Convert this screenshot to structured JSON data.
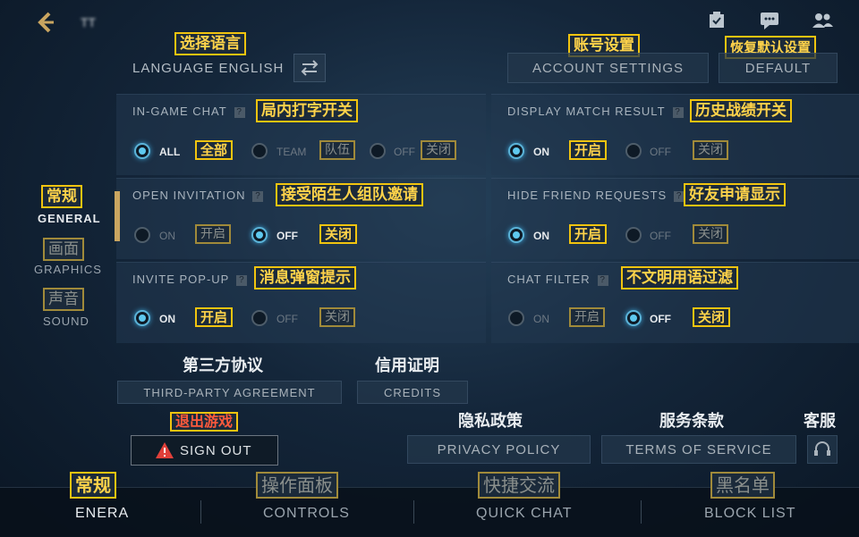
{
  "top": {
    "title_obscured": "TT"
  },
  "language": {
    "label": "LANGUAGE ENGLISH",
    "cn": "选择语言"
  },
  "account": {
    "label": "ACCOUNT SETTINGS",
    "cn": "账号设置"
  },
  "default": {
    "label": "DEFAULT",
    "cn": "恢复默认设置"
  },
  "settings": {
    "ingame_chat": {
      "label": "IN-GAME CHAT",
      "cn": "局内打字开关",
      "opt1": "ALL",
      "opt1_cn": "全部",
      "opt2": "TEAM",
      "opt2_cn": "队伍",
      "opt3": "OFF",
      "opt3_cn": "关闭"
    },
    "display_match": {
      "label": "DISPLAY MATCH RESULT",
      "cn": "历史战绩开关",
      "opt1": "ON",
      "opt1_cn": "开启",
      "opt2": "OFF",
      "opt2_cn": "关闭"
    },
    "open_invitation": {
      "label": "OPEN INVITATION",
      "cn": "接受陌生人组队邀请",
      "opt1": "ON",
      "opt1_cn": "开启",
      "opt2": "OFF",
      "opt2_cn": "关闭"
    },
    "hide_friend": {
      "label": "HIDE FRIEND REQUESTS",
      "cn": "好友申请显示",
      "opt1": "ON",
      "opt1_cn": "开启",
      "opt2": "OFF",
      "opt2_cn": "关闭"
    },
    "invite_popup": {
      "label": "INVITE POP-UP",
      "cn": "消息弹窗提示",
      "opt1": "ON",
      "opt1_cn": "开启",
      "opt2": "OFF",
      "opt2_cn": "关闭"
    },
    "chat_filter": {
      "label": "CHAT FILTER",
      "cn": "不文明用语过滤",
      "opt1": "ON",
      "opt1_cn": "开启",
      "opt2": "OFF",
      "opt2_cn": "关闭"
    }
  },
  "sidenav": {
    "general": {
      "label": "GENERAL",
      "cn": "常规"
    },
    "graphics": {
      "label": "GRAPHICS",
      "cn": "画面"
    },
    "sound": {
      "label": "SOUND",
      "cn": "声音"
    }
  },
  "links": {
    "third_party": {
      "label": "THIRD-PARTY AGREEMENT",
      "cn": "第三方协议"
    },
    "credits": {
      "label": "CREDITS",
      "cn": "信用证明"
    },
    "sign_out": {
      "label": "SIGN OUT",
      "cn": "退出游戏"
    },
    "privacy": {
      "label": "PRIVACY POLICY",
      "cn": "隐私政策"
    },
    "terms": {
      "label": "TERMS OF SERVICE",
      "cn": "服务条款"
    },
    "support": {
      "cn": "客服"
    }
  },
  "tabs": {
    "general": {
      "label": "ENERA",
      "cn": "常规"
    },
    "controls": {
      "label": "CONTROLS",
      "cn": "操作面板"
    },
    "quick_chat": {
      "label": "QUICK CHAT",
      "cn": "快捷交流"
    },
    "block_list": {
      "label": "BLOCK LIST",
      "cn": "黑名单"
    }
  },
  "colors": {
    "accent": "#5ec8ee",
    "highlight": "#f1c40f",
    "warning": "#e0403a"
  }
}
